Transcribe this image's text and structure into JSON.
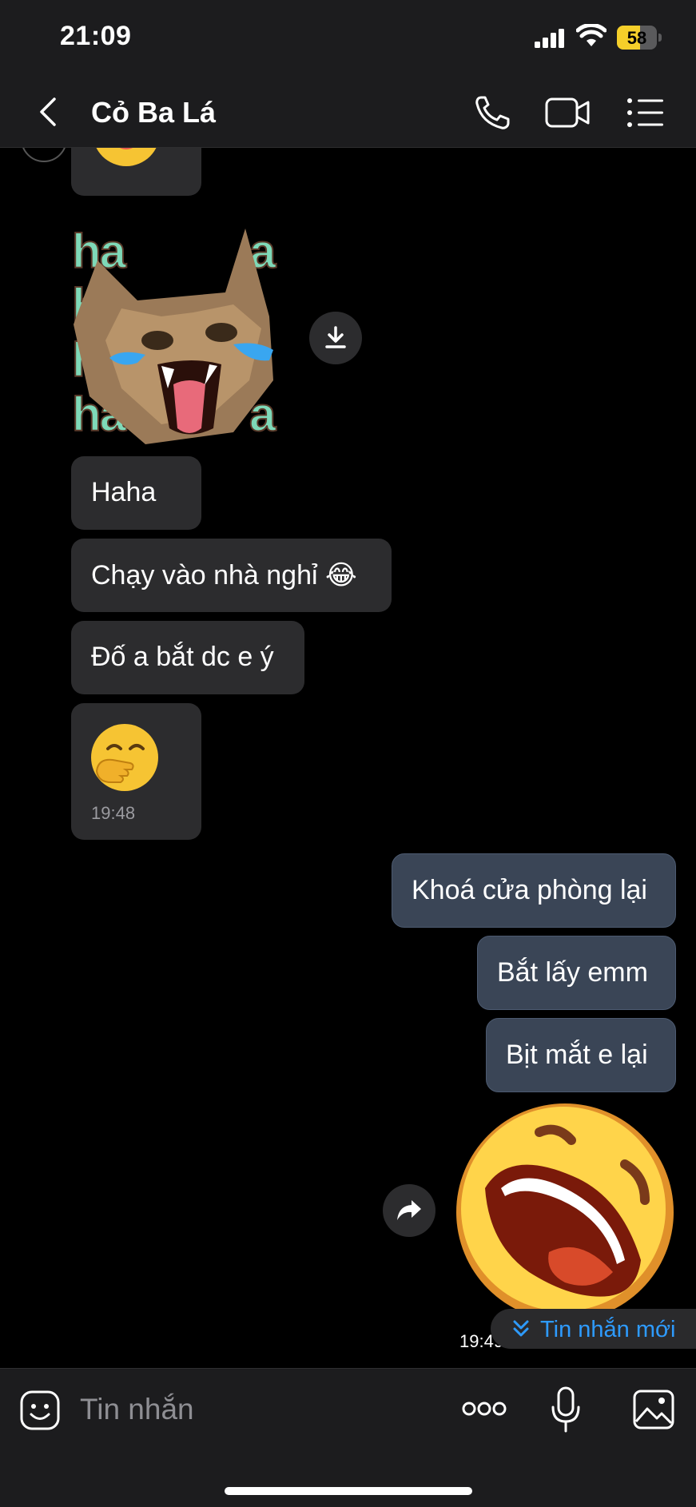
{
  "status_bar": {
    "time": "21:09",
    "battery": "58",
    "battery_level": 0.58
  },
  "header": {
    "contact_name": "Cỏ Ba Lá",
    "icons": [
      "back-chevron-icon",
      "phone-icon",
      "video-camera-icon",
      "list-menu-icon"
    ]
  },
  "messages": {
    "incoming": [
      {
        "type": "emoji",
        "icon": "laughing-tears-emoji"
      },
      {
        "type": "sticker",
        "icon": "laughing-cat-sticker",
        "sticker_text": [
          "ha",
          "ha",
          "ha",
          "ha"
        ]
      },
      {
        "type": "text",
        "text": "Haha"
      },
      {
        "type": "text",
        "text": "Chạy vào nhà nghỉ 😂"
      },
      {
        "type": "text",
        "text": "Đố a bắt dc e ý"
      },
      {
        "type": "emoji",
        "icon": "face-with-hand-over-mouth-emoji",
        "time": "19:48"
      }
    ],
    "outgoing": [
      {
        "type": "text",
        "text": "Khoá cửa phòng lại"
      },
      {
        "type": "text",
        "text": "Bắt lấy emm"
      },
      {
        "type": "text",
        "text": "Bịt mắt e lại"
      },
      {
        "type": "sticker",
        "icon": "rolling-laughing-face-sticker",
        "time": "19:49"
      }
    ]
  },
  "new_messages_pill": {
    "label": "Tin nhắn mới"
  },
  "composer": {
    "placeholder": "Tin nhắn"
  },
  "colors": {
    "accent": "#2e9bff",
    "incoming_bubble": "#2c2c2e",
    "outgoing_bubble": "#3a4556"
  }
}
